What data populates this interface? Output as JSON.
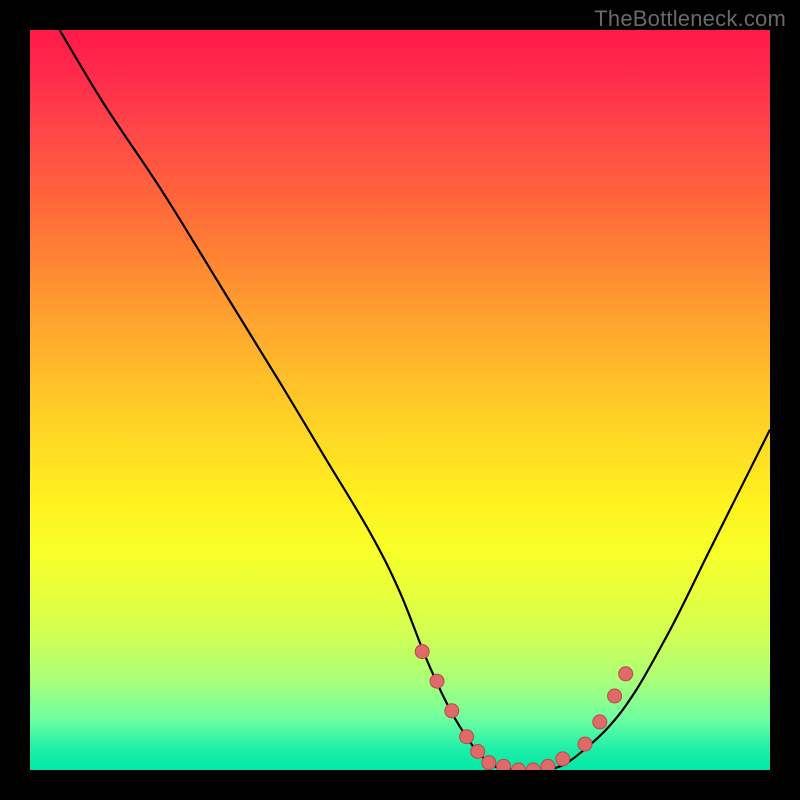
{
  "watermark": "TheBottleneck.com",
  "chart_data": {
    "type": "line",
    "title": "",
    "xlabel": "",
    "ylabel": "",
    "xlim": [
      0,
      100
    ],
    "ylim": [
      0,
      100
    ],
    "grid": false,
    "legend": false,
    "series": [
      {
        "name": "bottleneck-curve",
        "x": [
          4,
          10,
          18,
          26,
          34,
          40,
          46,
          50,
          54,
          58,
          62,
          66,
          70,
          74,
          80,
          86,
          92,
          100
        ],
        "y": [
          100,
          90,
          78,
          65,
          52,
          42,
          32,
          24,
          14,
          6,
          1,
          0,
          0,
          2,
          8,
          18,
          30,
          46
        ]
      }
    ],
    "markers": {
      "name": "highlight-points",
      "x": [
        53,
        55,
        57,
        59,
        60.5,
        62,
        64,
        66,
        68,
        70,
        72,
        75,
        77,
        79,
        80.5
      ],
      "y": [
        16,
        12,
        8,
        4.5,
        2.5,
        1,
        0.5,
        0,
        0,
        0.5,
        1.5,
        3.5,
        6.5,
        10,
        13
      ]
    }
  }
}
